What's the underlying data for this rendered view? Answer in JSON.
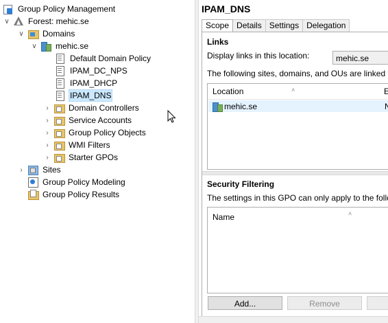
{
  "tree": {
    "root": "Group Policy Management",
    "forest": "Forest: mehic.se",
    "domains": "Domains",
    "domain": "mehic.se",
    "gpos": [
      "Default Domain Policy",
      "IPAM_DC_NPS",
      "IPAM_DHCP",
      "IPAM_DNS"
    ],
    "containers": [
      "Domain Controllers",
      "Service Accounts",
      "Group Policy Objects",
      "WMI Filters",
      "Starter GPOs"
    ],
    "sites": "Sites",
    "modeling": "Group Policy Modeling",
    "results": "Group Policy Results"
  },
  "details": {
    "title": "IPAM_DNS",
    "tabs": [
      "Scope",
      "Details",
      "Settings",
      "Delegation"
    ],
    "active_tab": "Scope",
    "links": {
      "heading": "Links",
      "display_label": "Display links in this location:",
      "location_value": "mehic.se",
      "description": "The following sites, domains, and OUs are linked to this G",
      "columns": [
        "Location",
        "E"
      ],
      "rows": [
        {
          "location": "mehic.se",
          "col2": "N"
        }
      ]
    },
    "security": {
      "heading": "Security Filtering",
      "description": "The settings in this GPO can only apply to the following g",
      "columns": [
        "Name"
      ],
      "buttons": [
        "Add...",
        "Remove"
      ]
    }
  }
}
